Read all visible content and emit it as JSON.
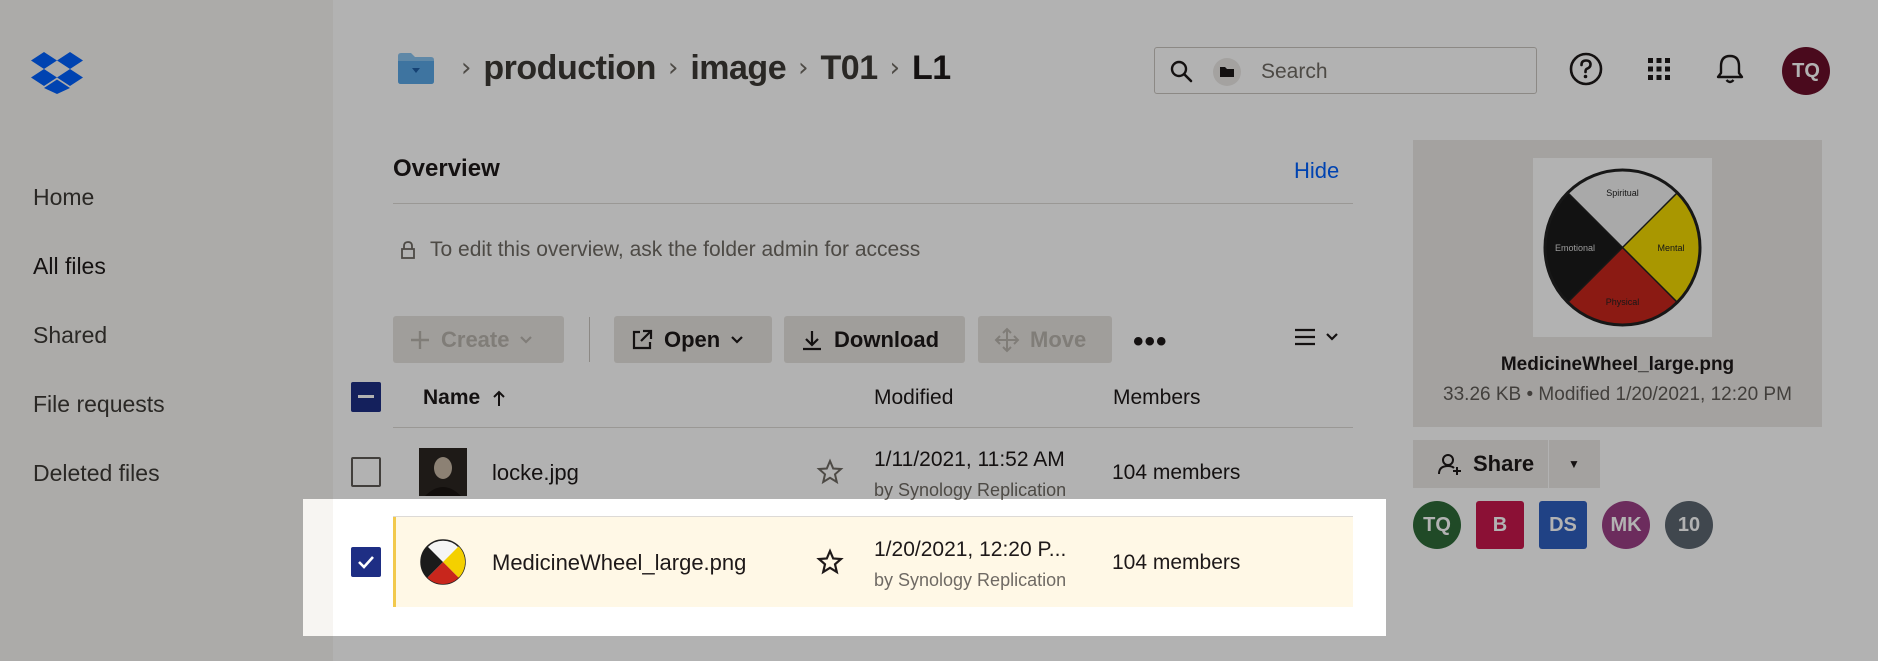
{
  "sidebar": {
    "items": [
      {
        "label": "Home"
      },
      {
        "label": "All files"
      },
      {
        "label": "Shared"
      },
      {
        "label": "File requests"
      },
      {
        "label": "Deleted files"
      }
    ]
  },
  "breadcrumb": [
    "production",
    "image",
    "T01",
    "L1"
  ],
  "search": {
    "placeholder": "Search"
  },
  "user": {
    "initials": "TQ"
  },
  "overview": {
    "title": "Overview",
    "hide_label": "Hide",
    "note": "To edit this overview, ask the folder admin for access"
  },
  "toolbar": {
    "create": "Create",
    "open": "Open",
    "download": "Download",
    "move": "Move"
  },
  "table": {
    "headers": {
      "name": "Name",
      "modified": "Modified",
      "members": "Members"
    },
    "rows": [
      {
        "name": "locke.jpg",
        "modified": "1/11/2021, 11:52 AM",
        "by": "by Synology Replication",
        "members": "104 members",
        "checked": false
      },
      {
        "name": "MedicineWheel_large.png",
        "modified": "1/20/2021, 12:20 P...",
        "by": "by Synology Replication",
        "members": "104 members",
        "checked": true
      }
    ]
  },
  "preview": {
    "filename": "MedicineWheel_large.png",
    "meta": "33.26 KB • Modified 1/20/2021, 12:20 PM",
    "wheel_labels": [
      "Spiritual",
      "Mental",
      "Physical",
      "Emotional"
    ]
  },
  "share": {
    "label": "Share"
  },
  "members": [
    {
      "initials": "TQ",
      "color": "#2e6b39"
    },
    {
      "initials": "B",
      "color": "#c8174c"
    },
    {
      "initials": "DS",
      "color": "#2f5fbf"
    },
    {
      "initials": "MK",
      "color": "#9b3f86"
    },
    {
      "initials": "10",
      "color": "#5c6670"
    }
  ],
  "colors": {
    "accent": "#0061fe",
    "checkbox": "#1e2e84",
    "selected_row": "#fff8e6"
  }
}
